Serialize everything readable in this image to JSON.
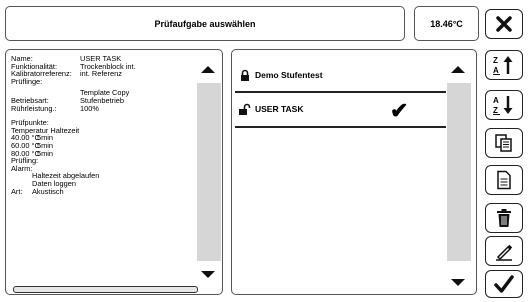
{
  "header": {
    "title": "Prüfaufgabe auswählen",
    "temperature": "18.46°C"
  },
  "details": {
    "rows": [
      {
        "key": "Name:",
        "value": "USER TASK"
      },
      {
        "key": "Funktionalität:",
        "value": "Trockenblock int."
      },
      {
        "key": "Kalibratorreferenz:",
        "value": "int. Referenz"
      },
      {
        "key": "Prüflinge:",
        "value": ""
      },
      {
        "key": "",
        "value": "Template Copy"
      },
      {
        "key": "Betriebsart:",
        "value": "Stufenbetrieb"
      },
      {
        "key": "Rührleistung.:",
        "value": "100%"
      }
    ],
    "pruefpunkte_label": "Prüfpunkte:",
    "pruefpunkte_header": "Temperatur Haltezeit",
    "pruefpunkte": [
      {
        "temp": "40.00 °C",
        "time": "5min"
      },
      {
        "temp": "60.00 °C",
        "time": "5min"
      },
      {
        "temp": "80.00 °C",
        "time": "5min"
      }
    ],
    "pruefling_label": "Prüfling:",
    "alarm_label": "Alarm:",
    "alarm_lines": [
      "Haltezeit abgelaufen",
      "Daten loggen"
    ],
    "art_label": "Art:",
    "art_value": "Akustisch"
  },
  "tasks": [
    {
      "label": "Demo Stufentest",
      "icon": "lock-closed-icon",
      "selected": false
    },
    {
      "label": "USER TASK",
      "icon": "lock-open-icon",
      "selected": true
    }
  ],
  "toolbar": {
    "buttons": [
      "close-icon",
      "sort-za-icon",
      "sort-az-icon",
      "copy-icon",
      "document-icon",
      "delete-icon",
      "edit-icon",
      "confirm-icon"
    ]
  }
}
